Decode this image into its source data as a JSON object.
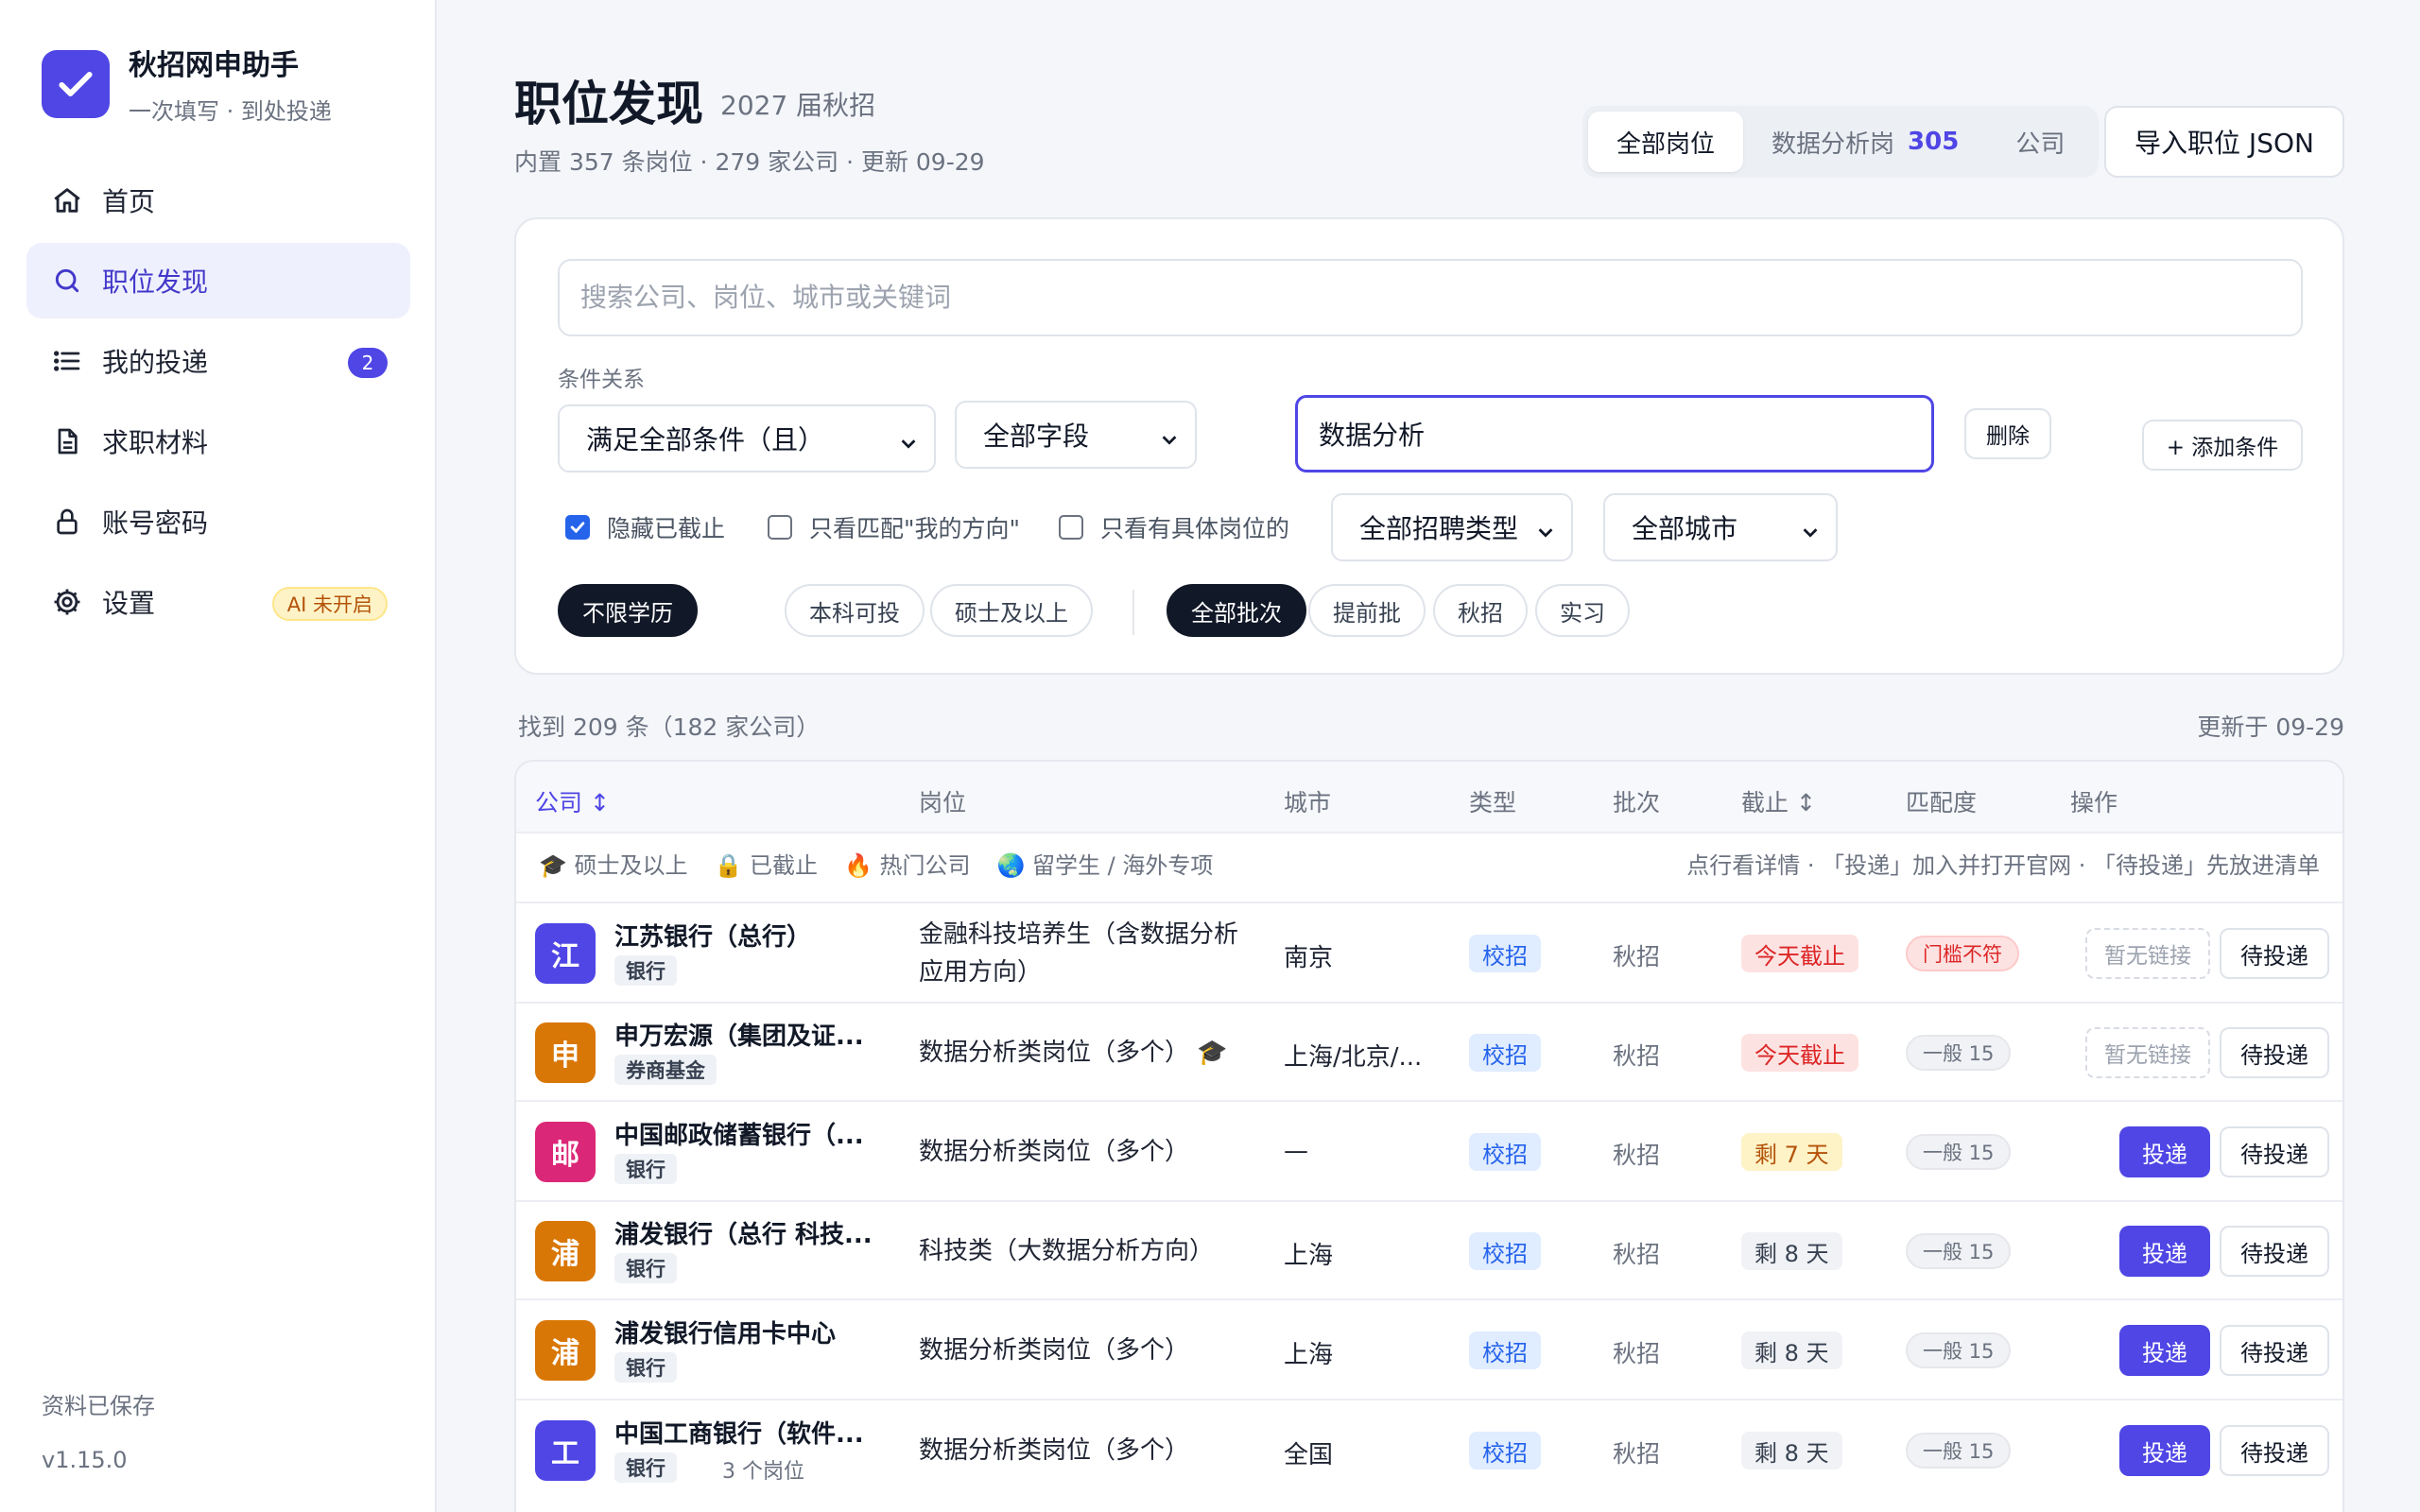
{
  "brand": {
    "title": "秋招网申助手",
    "subtitle": "一次填写 · 到处投递"
  },
  "nav": [
    {
      "label": "首页"
    },
    {
      "label": "职位发现"
    },
    {
      "label": "我的投递",
      "badge": "2"
    },
    {
      "label": "求职材料"
    },
    {
      "label": "账号密码"
    },
    {
      "label": "设置",
      "tag": "AI 未开启"
    }
  ],
  "footer": {
    "saved": "资料已保存",
    "version": "v1.15.0"
  },
  "header": {
    "title": "职位发现",
    "season": "2027 届秋招",
    "meta": "内置 357 条岗位 · 279 家公司 · 更新 09-29",
    "tabs": [
      {
        "label": "全部岗位"
      },
      {
        "label": "数据分析岗",
        "count": "305"
      },
      {
        "label": "公司"
      }
    ],
    "import_label": "导入职位 JSON"
  },
  "filters": {
    "search_placeholder": "搜索公司、岗位、城市或关键词",
    "cond_label": "条件关系",
    "logic": "满足全部条件（且）",
    "field": "全部字段",
    "keyword": "数据分析",
    "delete_label": "删除",
    "add_label": "+ 添加条件",
    "checks": [
      {
        "label": "隐藏已截止",
        "checked": true
      },
      {
        "label": "只看匹配\"我的方向\"",
        "checked": false
      },
      {
        "label": "只看有具体岗位的",
        "checked": false
      }
    ],
    "recruit_type": "全部招聘类型",
    "city": "全部城市",
    "edu_pills": [
      "不限学历",
      "本科可投",
      "硕士及以上"
    ],
    "batch_pills": [
      "全部批次",
      "提前批",
      "秋招",
      "实习"
    ]
  },
  "results": {
    "found": "找到 209 条（182 家公司）",
    "updated": "更新于 09-29"
  },
  "table": {
    "headers": [
      "公司 ↕",
      "岗位",
      "城市",
      "类型",
      "批次",
      "截止 ↕",
      "匹配度",
      "操作"
    ],
    "legend": [
      "🎓 硕士及以上",
      "🔒 已截止",
      "🔥 热门公司",
      "🌏 留学生 / 海外专项"
    ],
    "tip": "点行看详情 · 「投递」加入并打开官网 · 「待投递」先放进清单",
    "no_link_label": "暂无链接",
    "apply_label": "投递",
    "later_label": "待投递",
    "rows": [
      {
        "initial": "江",
        "color": "#4f46e5",
        "company": "江苏银行（总行）",
        "tag": "银行",
        "extra": "",
        "position": "金融科技培养生（含数据分析\n应用方向）",
        "city": "南京",
        "type": "校招",
        "batch": "秋招",
        "deadline": "今天截止",
        "dl_style": "red",
        "match": "门槛不符",
        "match_style": "red",
        "has_link": false
      },
      {
        "initial": "申",
        "color": "#d97706",
        "company": "申万宏源（集团及证...",
        "tag": "券商基金",
        "extra": "",
        "position": "数据分析类岗位（多个） 🎓",
        "city": "上海/北京/...",
        "type": "校招",
        "batch": "秋招",
        "deadline": "今天截止",
        "dl_style": "red",
        "match": "一般 15",
        "match_style": "gray",
        "has_link": false
      },
      {
        "initial": "邮",
        "color": "#db2777",
        "company": "中国邮政储蓄银行（...",
        "tag": "银行",
        "extra": "",
        "position": "数据分析类岗位（多个）",
        "city": "—",
        "type": "校招",
        "batch": "秋招",
        "deadline": "剩 7 天",
        "dl_style": "yellow",
        "match": "一般 15",
        "match_style": "gray",
        "has_link": true
      },
      {
        "initial": "浦",
        "color": "#d97706",
        "company": "浦发银行（总行 科技...",
        "tag": "银行",
        "extra": "",
        "position": "科技类（大数据分析方向）",
        "city": "上海",
        "type": "校招",
        "batch": "秋招",
        "deadline": "剩 8 天",
        "dl_style": "gray",
        "match": "一般 15",
        "match_style": "gray",
        "has_link": true
      },
      {
        "initial": "浦",
        "color": "#d97706",
        "company": "浦发银行信用卡中心",
        "tag": "银行",
        "extra": "",
        "position": "数据分析类岗位（多个）",
        "city": "上海",
        "type": "校招",
        "batch": "秋招",
        "deadline": "剩 8 天",
        "dl_style": "gray",
        "match": "一般 15",
        "match_style": "gray",
        "has_link": true
      },
      {
        "initial": "工",
        "color": "#4f46e5",
        "company": "中国工商银行（软件...",
        "tag": "银行",
        "extra": "3 个岗位",
        "position": "数据分析类岗位（多个）",
        "city": "全国",
        "type": "校招",
        "batch": "秋招",
        "deadline": "剩 8 天",
        "dl_style": "gray",
        "match": "一般 15",
        "match_style": "gray",
        "has_link": true
      }
    ]
  }
}
